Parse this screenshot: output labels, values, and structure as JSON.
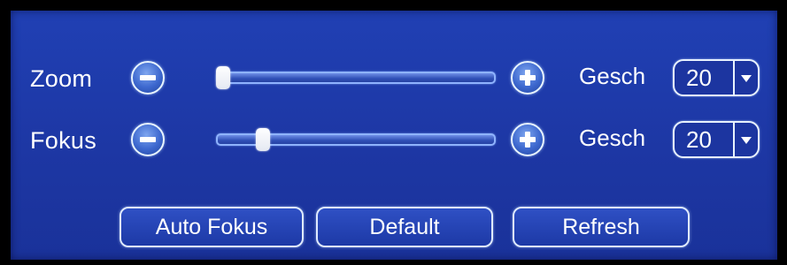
{
  "rows": [
    {
      "label": "Zoom",
      "position": 0.0,
      "speed_label": "Gesch",
      "speed_value": "20"
    },
    {
      "label": "Fokus",
      "position": 0.15,
      "speed_label": "Gesch",
      "speed_value": "20"
    }
  ],
  "buttons": {
    "auto_focus": "Auto Fokus",
    "default": "Default",
    "refresh": "Refresh"
  },
  "colors": {
    "panel": "#1f3aa8",
    "outer_frame": "#000000",
    "text": "#ffffff"
  },
  "icons": {
    "decrease": "minus-circle-icon",
    "increase": "plus-circle-icon",
    "dropdown": "chevron-down-icon"
  }
}
